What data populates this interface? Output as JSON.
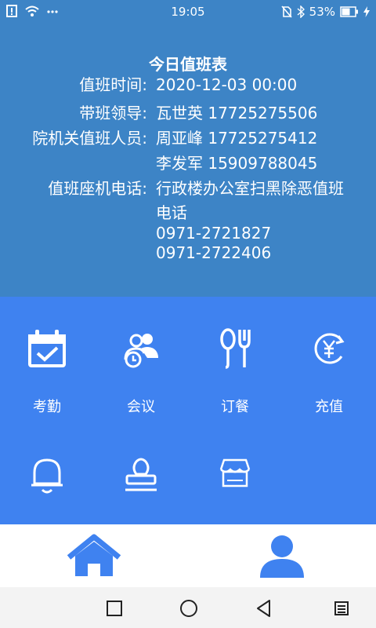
{
  "status": {
    "time": "19:05",
    "battery_text": "53%",
    "icons": [
      "alert-icon",
      "wifi-icon",
      "more-icon",
      "no-sim-icon",
      "bluetooth-icon",
      "battery-icon",
      "charging-icon"
    ]
  },
  "duty": {
    "title": "今日值班表",
    "rows": [
      {
        "label": "值班时间:",
        "value": "2020-12-03 00:00"
      },
      {
        "label": "带班领导:",
        "value": "瓦世英 17725275506"
      },
      {
        "label": "院机关值班人员:",
        "value": "周亚峰 17725275412"
      },
      {
        "label": "",
        "value": "李发军 15909788045"
      },
      {
        "label": "值班座机电话:",
        "value": "行政楼办公室扫黑除恶值班"
      },
      {
        "label": "",
        "value": "电话"
      },
      {
        "label": "",
        "value": "0971-2721827"
      },
      {
        "label": "",
        "value": "0971-2722406"
      }
    ]
  },
  "grid": {
    "items": [
      {
        "label": "考勤",
        "icon": "calendar-check-icon"
      },
      {
        "label": "会议",
        "icon": "meeting-icon"
      },
      {
        "label": "订餐",
        "icon": "dining-icon"
      },
      {
        "label": "充值",
        "icon": "recharge-icon"
      },
      {
        "label": "",
        "icon": "bell-icon"
      },
      {
        "label": "",
        "icon": "stamp-icon"
      },
      {
        "label": "",
        "icon": "shop-icon"
      }
    ]
  },
  "tabbar": {
    "tabs": [
      {
        "icon": "home-icon",
        "color": "#3f82f0"
      },
      {
        "icon": "profile-icon",
        "color": "#3f82f0"
      }
    ]
  },
  "colors": {
    "panel": "#3d84c6",
    "grid": "#3f82f0"
  }
}
